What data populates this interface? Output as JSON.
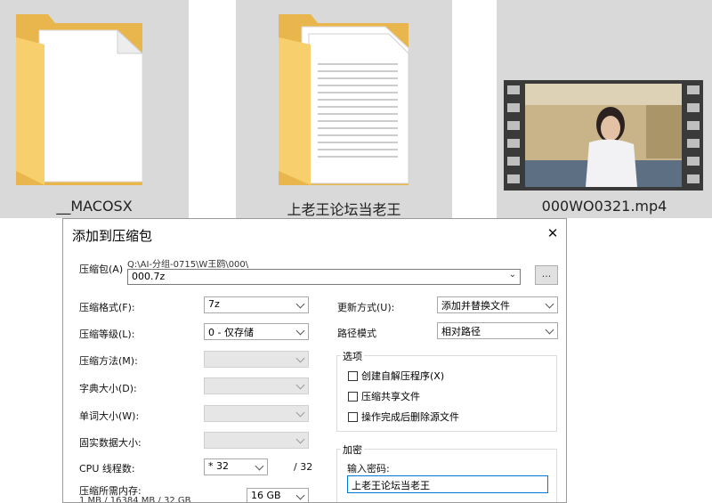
{
  "explorer": {
    "items": [
      {
        "name": "__MACOSX",
        "type": "folder"
      },
      {
        "name": "上老王论坛当老王",
        "type": "folder"
      },
      {
        "name": "000WO0321.mp4",
        "type": "video"
      }
    ]
  },
  "dialog": {
    "title": "添加到压缩包",
    "close": "✕",
    "archive": {
      "label": "压缩包(A)",
      "path": "Q:\\AI-分组-0715\\W王鸥\\000\\",
      "value": "000.7z",
      "browse": "..."
    },
    "left": [
      {
        "label": "压缩格式(F):",
        "value": "7z",
        "enabled": true
      },
      {
        "label": "压缩等级(L):",
        "value": "0 - 仅存储",
        "enabled": true
      },
      {
        "label": "压缩方法(M):",
        "value": "",
        "enabled": false
      },
      {
        "label": "字典大小(D):",
        "value": "",
        "enabled": false
      },
      {
        "label": "单词大小(W):",
        "value": "",
        "enabled": false
      },
      {
        "label": "固实数据大小:",
        "value": "",
        "enabled": false
      }
    ],
    "cpu": {
      "label": "CPU 线程数:",
      "value": "* 32",
      "max": "/ 32"
    },
    "memory": {
      "label": "压缩所需内存:",
      "detail": "1 MB / 16384 MB / 32 GB",
      "value": "16 GB"
    },
    "right": {
      "update_label": "更新方式(U):",
      "update_value": "添加并替换文件",
      "path_label": "路径模式",
      "path_value": "相对路径",
      "options_title": "选项",
      "options": [
        "创建自解压程序(X)",
        "压缩共享文件",
        "操作完成后删除源文件"
      ],
      "encrypt_title": "加密",
      "password_label": "输入密码:",
      "password_value": "上老王论坛当老王"
    }
  }
}
